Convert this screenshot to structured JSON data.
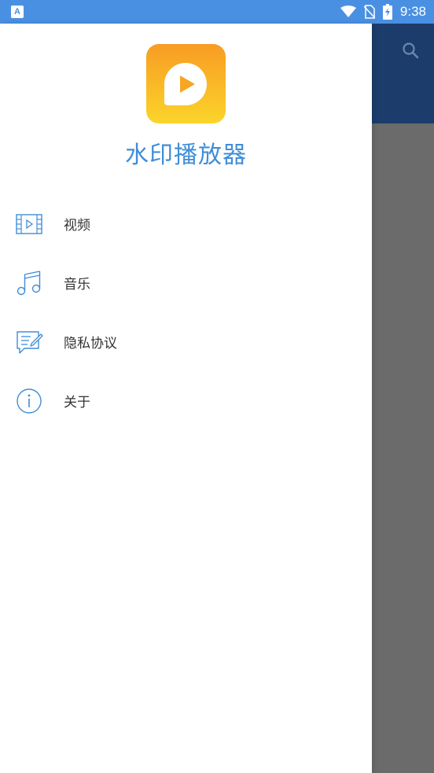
{
  "status_bar": {
    "app_icon_letter": "A",
    "time": "9:38"
  },
  "drawer": {
    "app_name": "水印播放器",
    "menu": [
      {
        "label": "视频",
        "icon": "video-icon"
      },
      {
        "label": "音乐",
        "icon": "music-icon"
      },
      {
        "label": "隐私协议",
        "icon": "privacy-doc-icon"
      },
      {
        "label": "关于",
        "icon": "info-icon"
      }
    ]
  },
  "background_app": {
    "toolbar_icon": "search-icon"
  },
  "colors": {
    "status_bar": "#4a90e2",
    "accent": "#3f8ed8",
    "toolbar": "#1c3d6b",
    "scrim": "#6b6b6b",
    "logo_gradient_top": "#f89c24",
    "logo_gradient_bottom": "#fbd42a"
  }
}
